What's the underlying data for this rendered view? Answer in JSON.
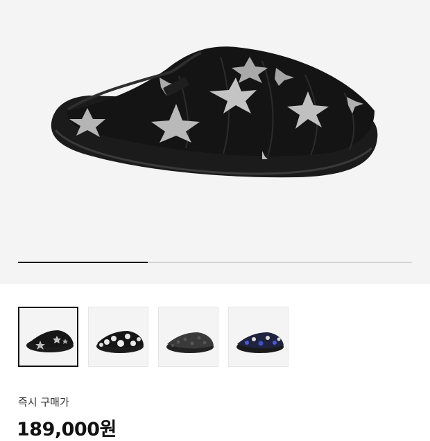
{
  "product": {
    "images": [
      {
        "name": "black-star-slipper",
        "selected": true
      },
      {
        "name": "black-polka-dot-slipper",
        "selected": false
      },
      {
        "name": "grey-leopard-slipper",
        "selected": false
      },
      {
        "name": "navy-dot-slipper",
        "selected": false
      }
    ],
    "gallery_progress": 0.33,
    "purchase_label": "즉시 구매가",
    "price": "189,000원"
  },
  "colors": {
    "hero_bg": "#f4f4f4",
    "text_primary": "#111111",
    "progress_track": "#d4d4d4"
  }
}
